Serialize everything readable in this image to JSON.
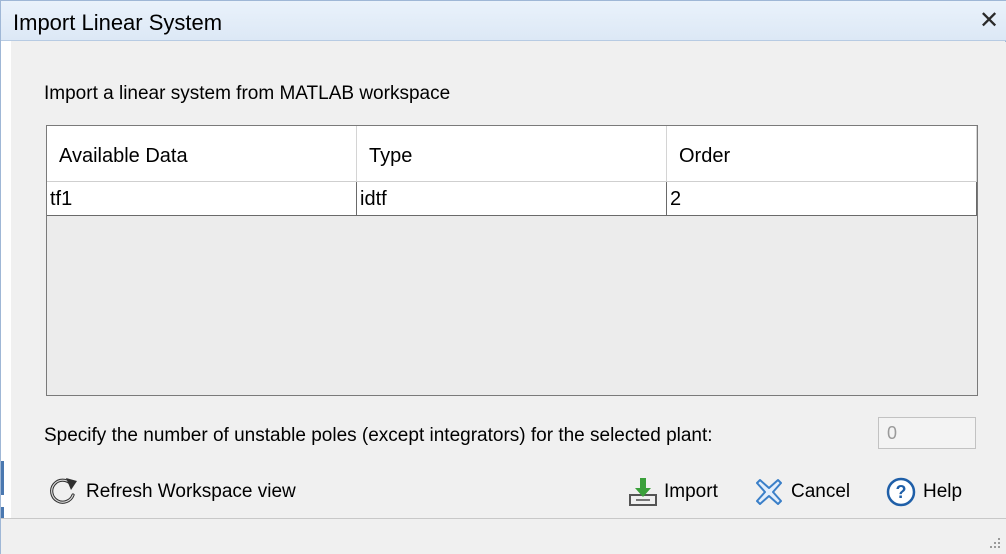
{
  "window": {
    "title": "Import Linear System",
    "close_glyph": "✕"
  },
  "instruction": "Import a linear system from MATLAB workspace",
  "table": {
    "columns": [
      "Available Data",
      "Type",
      "Order"
    ],
    "rows": [
      [
        "tf1",
        "idtf",
        "2"
      ]
    ]
  },
  "poles": {
    "label": "Specify the number of unstable poles (except integrators) for the selected plant:",
    "value": "0"
  },
  "buttons": {
    "refresh": "Refresh Workspace view",
    "import": "Import",
    "cancel": "Cancel",
    "help": "Help"
  },
  "icons": {
    "refresh": "refresh-arrow-icon",
    "import": "import-download-icon",
    "cancel": "cancel-x-icon",
    "help": "help-question-icon"
  },
  "colors": {
    "title_bar": "#dce8f6",
    "import_arrow": "#3aa03a",
    "cancel_icon": "#3a7fc8",
    "help_icon": "#1f5fa8"
  }
}
